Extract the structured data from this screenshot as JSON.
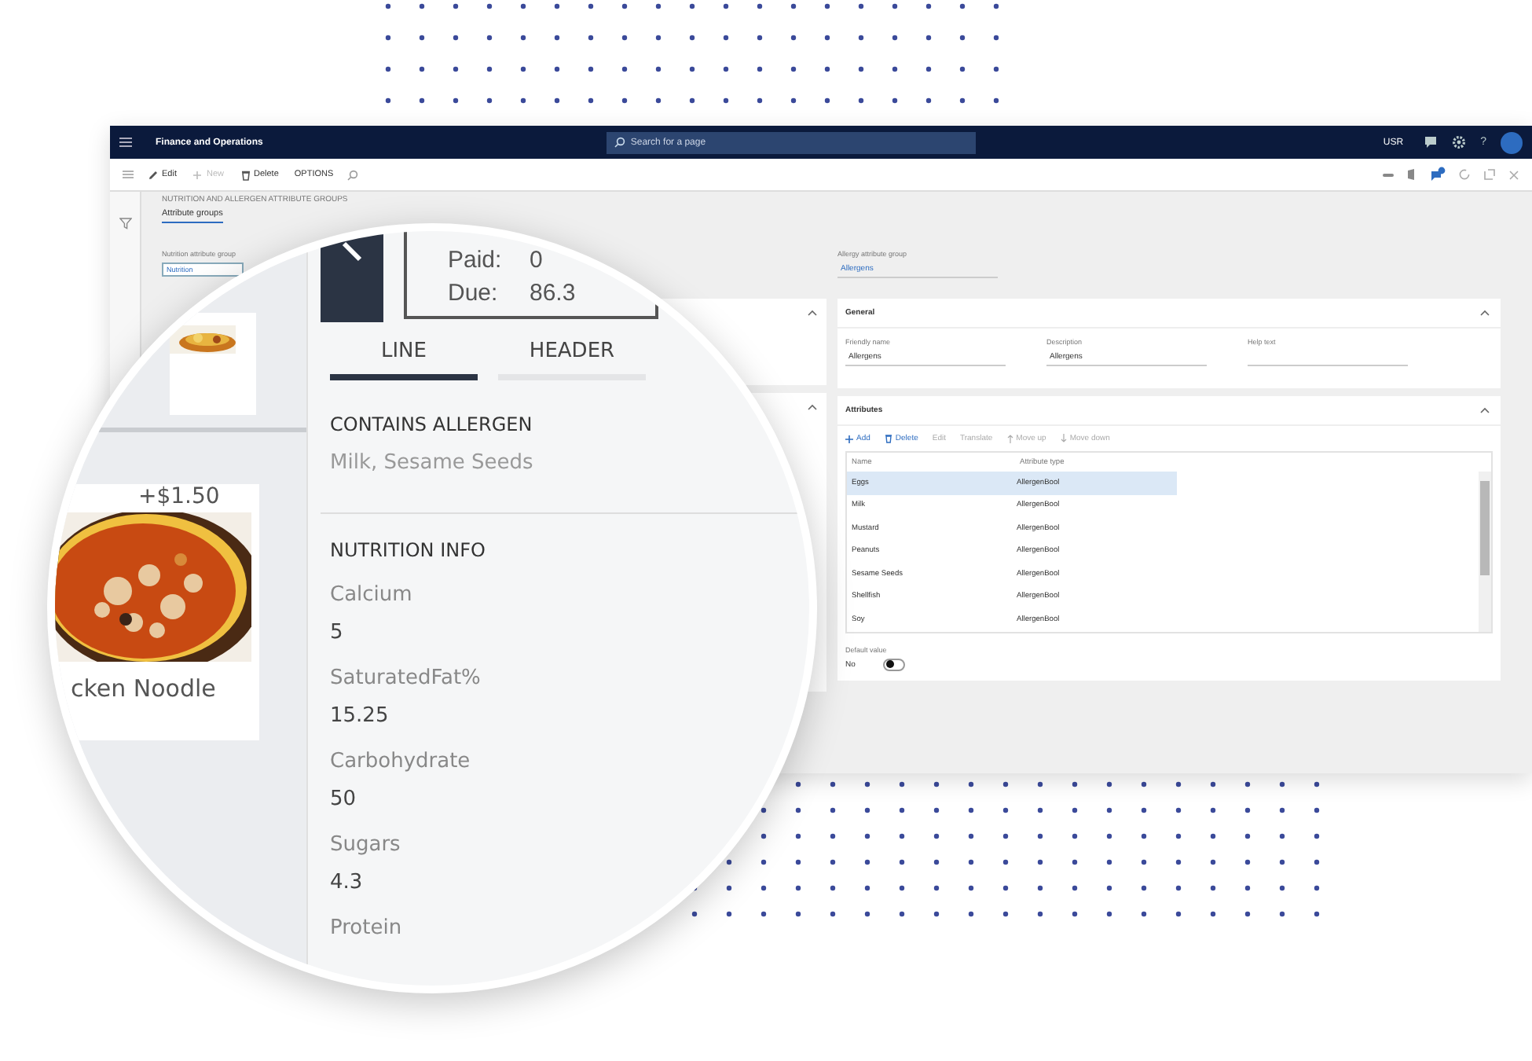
{
  "window": {
    "app_title": "Finance and Operations",
    "search": {
      "placeholder": "Search for a page"
    },
    "company": "USR",
    "help_glyph": "?"
  },
  "toolbar": [
    {
      "label": "Edit",
      "kind": "edit",
      "disabled": false
    },
    {
      "label": "New",
      "kind": "new",
      "disabled": true
    },
    {
      "label": "Delete",
      "kind": "delete",
      "disabled": false
    },
    {
      "label": "OPTIONS",
      "kind": "plain",
      "disabled": false
    }
  ],
  "page": {
    "title": "NUTRITION AND ALLERGEN ATTRIBUTE GROUPS",
    "tabs": [
      {
        "label": "Attribute groups",
        "selected": true
      }
    ],
    "nutrition_field": {
      "label": "Nutrition attribute group",
      "value": "Nutrition"
    },
    "allergy_field": {
      "label": "Allergy attribute group",
      "value": "Allergens"
    }
  },
  "general": {
    "title": "General",
    "expanded": true,
    "fields": [
      {
        "label": "Friendly name",
        "value": "Allergens"
      },
      {
        "label": "Description",
        "value": "Allergens"
      },
      {
        "label": "Help text"
      }
    ]
  },
  "attributes": {
    "title": "Attributes",
    "expanded": true,
    "actions": [
      {
        "label": "Add",
        "kind": "add",
        "disabled": false
      },
      {
        "label": "Delete",
        "kind": "delete",
        "disabled": false
      },
      {
        "label": "Edit",
        "kind": "plain",
        "disabled": true
      },
      {
        "label": "Translate",
        "kind": "plain",
        "disabled": true
      },
      {
        "label": "Move up",
        "kind": "up",
        "disabled": true
      },
      {
        "label": "Move down",
        "kind": "down",
        "disabled": true
      }
    ],
    "columns": [
      "Name",
      "Attribute type"
    ],
    "rows": [
      {
        "name": "Eggs",
        "type": "AllergenBool",
        "selected": true
      },
      {
        "name": "Milk",
        "type": "AllergenBool",
        "selected": false
      },
      {
        "name": "Mustard",
        "type": "AllergenBool",
        "selected": false
      },
      {
        "name": "Peanuts",
        "type": "AllergenBool",
        "selected": false
      },
      {
        "name": "Sesame Seeds",
        "type": "AllergenBool",
        "selected": false
      },
      {
        "name": "Shellfish",
        "type": "AllergenBool",
        "selected": false
      },
      {
        "name": "Soy",
        "type": "AllergenBool",
        "selected": false
      }
    ],
    "default_value": {
      "label": "Default value",
      "value": "No",
      "on": false
    }
  },
  "lens": {
    "paid_label": "Paid:",
    "paid": "0",
    "due_label": "Due:",
    "due": "86.3",
    "tabs": [
      {
        "label": "LINE",
        "selected": true
      },
      {
        "label": "HEADER",
        "selected": false
      }
    ],
    "allergen": {
      "title": "CONTAINS ALLERGEN",
      "value": "Milk, Sesame Seeds"
    },
    "nutrition": {
      "title": "NUTRITION INFO",
      "items": [
        {
          "label": "Calcium",
          "value": "5"
        },
        {
          "label": "SaturatedFat%",
          "value": "15.25"
        },
        {
          "label": "Carbohydrate",
          "value": "50"
        },
        {
          "label": "Sugars",
          "value": "4.3"
        },
        {
          "label": "Protein"
        }
      ]
    },
    "menu_item": {
      "price": "+$1.50",
      "name": "cken Noodle"
    }
  }
}
